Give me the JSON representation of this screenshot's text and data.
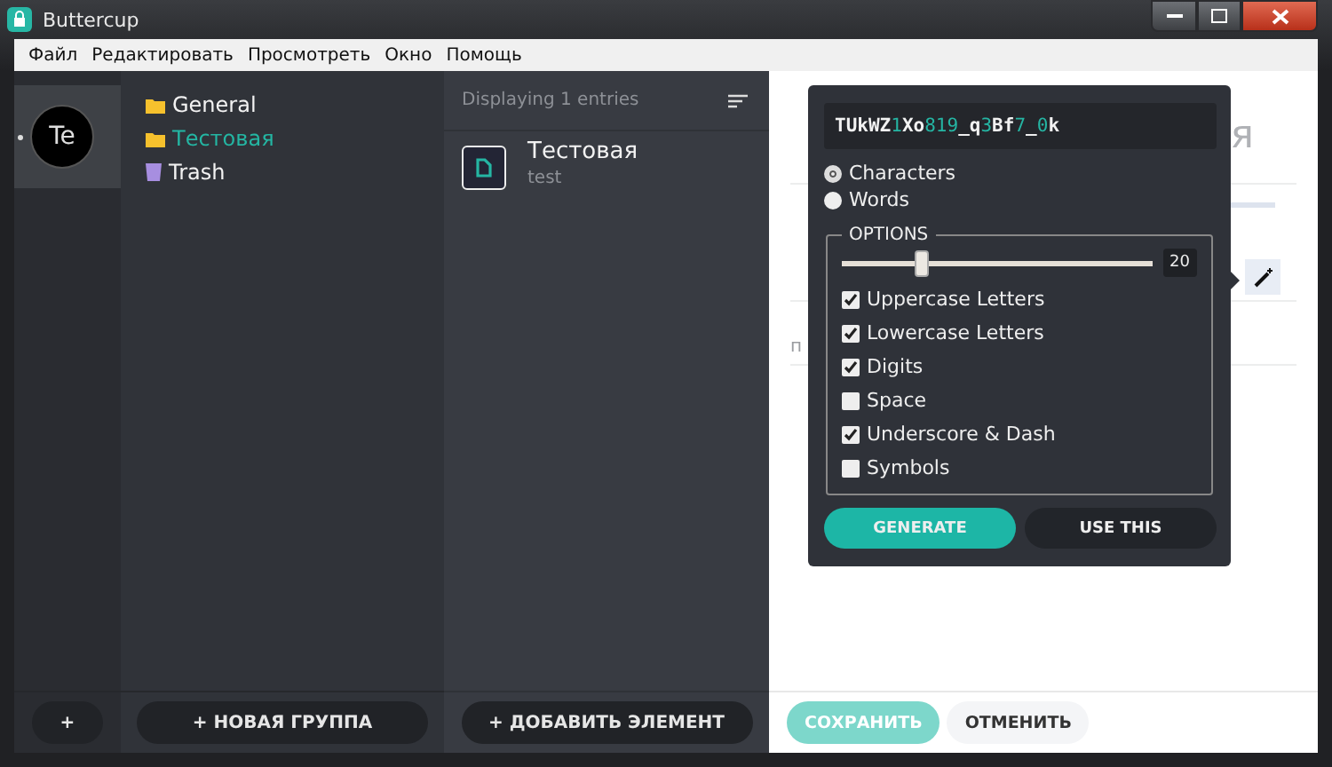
{
  "window": {
    "title": "Buttercup"
  },
  "menu": [
    "Файл",
    "Редактировать",
    "Просмотреть",
    "Окно",
    "Помощь"
  ],
  "vaults": [
    {
      "initials": "Te",
      "selected": true
    }
  ],
  "vault_add": "+",
  "groups": [
    {
      "label": "General",
      "kind": "folder",
      "selected": false
    },
    {
      "label": "Тестовая",
      "kind": "folder",
      "selected": true
    },
    {
      "label": "Trash",
      "kind": "trash",
      "selected": false
    }
  ],
  "new_group": "+ НОВАЯ ГРУППА",
  "entries_header": "Displaying 1 entries",
  "entries": [
    {
      "title": "Тестовая",
      "subtitle": "test"
    }
  ],
  "add_entry": "+ ДОБАВИТЬ ЭЛЕМЕНТ",
  "editor": {
    "title_fragment": "я",
    "label_fragment": "п",
    "save": "СОХРАНИТЬ",
    "cancel": "ОТМЕНИТЬ"
  },
  "generator": {
    "password": [
      {
        "text": "TUkWZ",
        "kind": "letter"
      },
      {
        "text": "1",
        "kind": "digit"
      },
      {
        "text": "Xo",
        "kind": "letter"
      },
      {
        "text": "819",
        "kind": "digit"
      },
      {
        "text": "_q",
        "kind": "letter"
      },
      {
        "text": "3",
        "kind": "digit"
      },
      {
        "text": "Bf",
        "kind": "letter"
      },
      {
        "text": "7",
        "kind": "digit"
      },
      {
        "text": "_",
        "kind": "letter"
      },
      {
        "text": "0",
        "kind": "digit"
      },
      {
        "text": "k",
        "kind": "letter"
      }
    ],
    "modes": [
      {
        "label": "Characters",
        "selected": true
      },
      {
        "label": "Words",
        "selected": false
      }
    ],
    "options_title": "OPTIONS",
    "length": {
      "level": 0.26,
      "reading": "20"
    },
    "options": [
      {
        "label": "Uppercase Letters",
        "checked": true
      },
      {
        "label": "Lowercase Letters",
        "checked": true
      },
      {
        "label": "Digits",
        "checked": true
      },
      {
        "label": "Space",
        "checked": false
      },
      {
        "label": "Underscore & Dash",
        "checked": true
      },
      {
        "label": "Symbols",
        "checked": false
      }
    ],
    "generate": "GENERATE",
    "use": "USE THIS"
  }
}
